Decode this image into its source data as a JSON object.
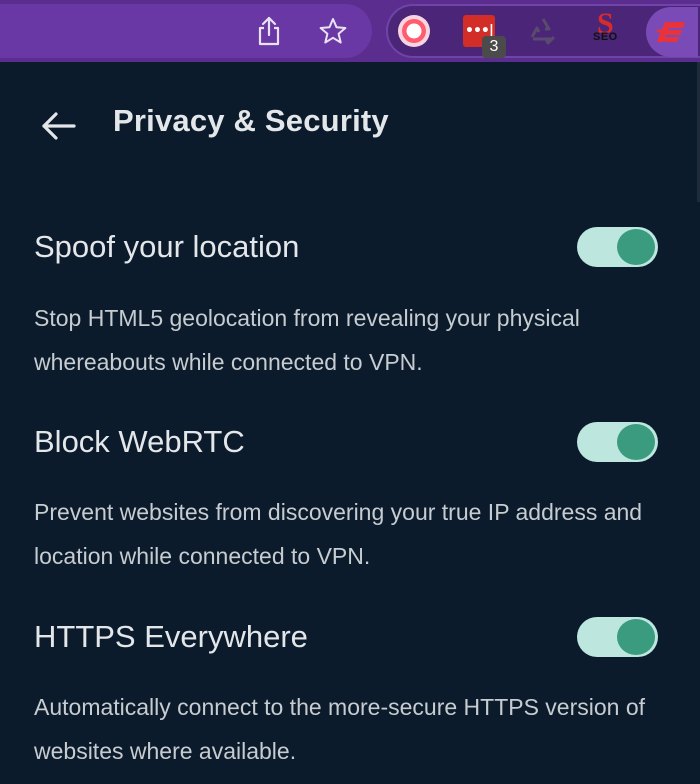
{
  "browser": {
    "extensions": [
      {
        "name": "record-extension"
      },
      {
        "name": "lastpass-extension",
        "icon_text": "•••|",
        "badge": "3"
      },
      {
        "name": "recycle-extension"
      },
      {
        "name": "seo-extension",
        "icon_text": "SEO",
        "logo_letter": "S"
      },
      {
        "name": "expressvpn-extension"
      }
    ]
  },
  "header": {
    "title": "Privacy & Security"
  },
  "settings": [
    {
      "title": "Spoof your location",
      "description": "Stop HTML5 geolocation from revealing your physical whereabouts while connected to VPN.",
      "enabled": true
    },
    {
      "title": "Block WebRTC",
      "description": "Prevent websites from discovering your true IP address and location while connected to VPN.",
      "enabled": true
    },
    {
      "title": "HTTPS Everywhere",
      "description": "Automatically connect to the more-secure HTTPS version of websites where available.",
      "enabled": true
    }
  ],
  "colors": {
    "toolbar": "#5b2d8e",
    "panel_background": "#0b1b2b",
    "toggle_track": "#bde6df",
    "toggle_knob": "#3a9b7f",
    "text_primary": "#e4e7ea"
  }
}
